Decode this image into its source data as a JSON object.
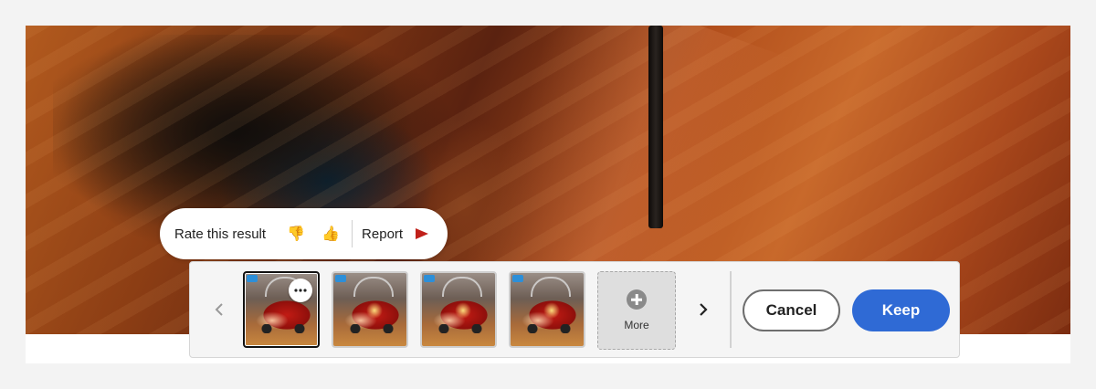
{
  "feedback": {
    "rate_label": "Rate this result",
    "thumbs_down_icon": "thumbs-down-icon",
    "thumbs_up_icon": "thumbs-up-icon",
    "report_label": "Report",
    "report_icon": "red-flag-icon",
    "flag_color": "#c0201a"
  },
  "tray": {
    "prev_icon": "chevron-left-icon",
    "next_icon": "chevron-right-icon",
    "thumbnails": [
      {
        "selected": true,
        "has_options": true
      },
      {
        "selected": false
      },
      {
        "selected": false
      },
      {
        "selected": false
      }
    ],
    "more_label": "More",
    "cancel_label": "Cancel",
    "keep_label": "Keep",
    "keep_color": "#2f6ad5"
  }
}
